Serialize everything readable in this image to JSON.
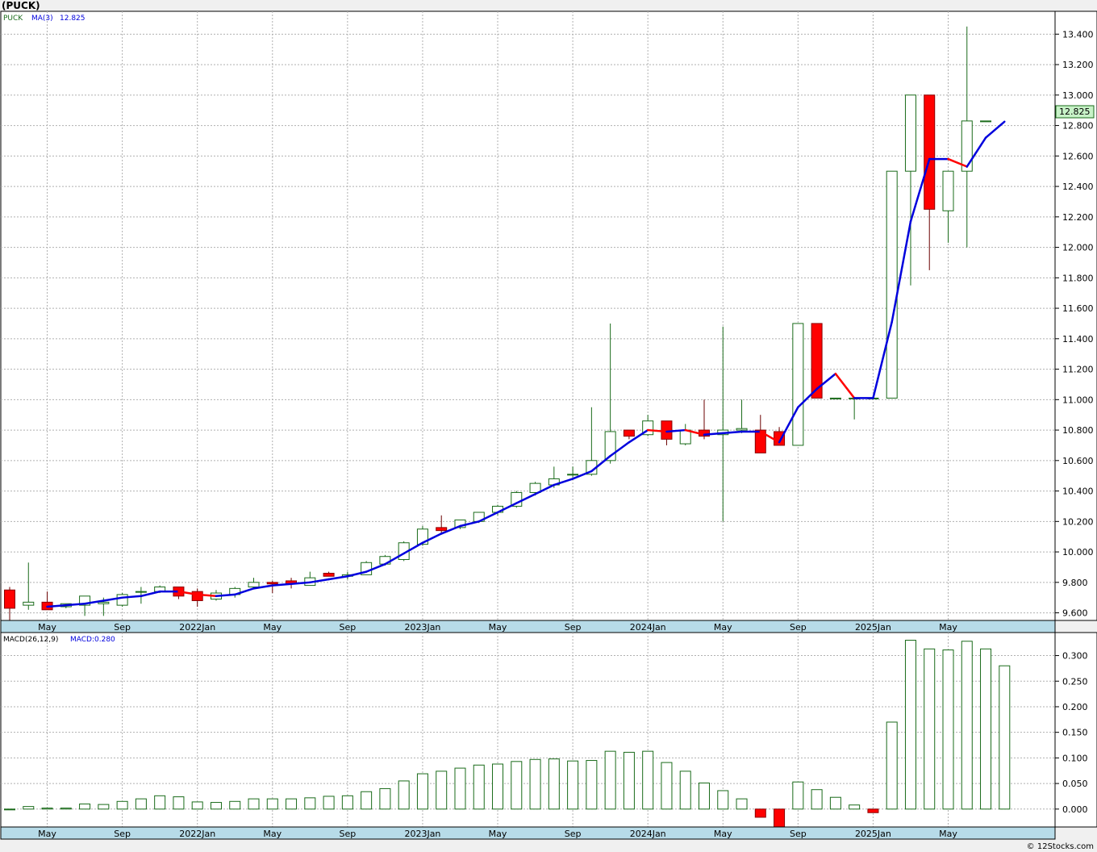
{
  "page_title": "(PUCK)",
  "credit": "© 12Stocks.com",
  "colors": {
    "up": "#1a6b1a",
    "down": "#ff0000",
    "ma_up": "#0000dd",
    "ma_down": "#ff0000",
    "axis_band": "#b7dbe8",
    "last_price_bg": "#c7f2c7"
  },
  "chart_data": [
    {
      "type": "candlestick",
      "legend": {
        "symbol": "PUCK",
        "ma_label": "MA(3)",
        "ma_value": "12.825"
      },
      "ylim": [
        9.55,
        13.55
      ],
      "y_ticks": [
        "9.600",
        "9.800",
        "10.000",
        "10.200",
        "10.400",
        "10.600",
        "10.800",
        "11.000",
        "11.200",
        "11.400",
        "11.600",
        "11.800",
        "12.000",
        "12.200",
        "12.400",
        "12.600",
        "12.800",
        "13.000",
        "13.200",
        "13.400"
      ],
      "last_price_label": "12.825",
      "x_labels": [
        {
          "label": "May",
          "index": 2
        },
        {
          "label": "Sep",
          "index": 6
        },
        {
          "label": "2022Jan",
          "index": 10
        },
        {
          "label": "May",
          "index": 14
        },
        {
          "label": "Sep",
          "index": 18
        },
        {
          "label": "2023Jan",
          "index": 22
        },
        {
          "label": "May",
          "index": 26
        },
        {
          "label": "Sep",
          "index": 30
        },
        {
          "label": "2024Jan",
          "index": 34
        },
        {
          "label": "May",
          "index": 38
        },
        {
          "label": "Sep",
          "index": 42
        },
        {
          "label": "2025Jan",
          "index": 46
        },
        {
          "label": "May",
          "index": 50
        }
      ],
      "candles": [
        [
          9.75,
          9.77,
          9.55,
          9.63
        ],
        [
          9.65,
          9.93,
          9.62,
          9.67
        ],
        [
          9.67,
          9.74,
          9.62,
          9.62
        ],
        [
          9.64,
          9.66,
          9.63,
          9.66
        ],
        [
          9.65,
          9.71,
          9.58,
          9.71
        ],
        [
          9.66,
          9.7,
          9.58,
          9.67
        ],
        [
          9.65,
          9.73,
          9.64,
          9.72
        ],
        [
          9.74,
          9.77,
          9.66,
          9.74
        ],
        [
          9.74,
          9.78,
          9.73,
          9.77
        ],
        [
          9.77,
          9.77,
          9.69,
          9.71
        ],
        [
          9.74,
          9.76,
          9.64,
          9.68
        ],
        [
          9.69,
          9.75,
          9.68,
          9.73
        ],
        [
          9.72,
          9.77,
          9.7,
          9.76
        ],
        [
          9.77,
          9.83,
          9.76,
          9.8
        ],
        [
          9.8,
          9.81,
          9.73,
          9.79
        ],
        [
          9.81,
          9.83,
          9.76,
          9.79
        ],
        [
          9.78,
          9.87,
          9.78,
          9.83
        ],
        [
          9.86,
          9.87,
          9.84,
          9.84
        ],
        [
          9.84,
          9.87,
          9.82,
          9.85
        ],
        [
          9.85,
          9.94,
          9.85,
          9.93
        ],
        [
          9.92,
          9.98,
          9.91,
          9.97
        ],
        [
          9.95,
          10.07,
          9.94,
          10.06
        ],
        [
          10.05,
          10.17,
          10.04,
          10.15
        ],
        [
          10.16,
          10.24,
          10.12,
          10.14
        ],
        [
          10.16,
          10.21,
          10.15,
          10.21
        ],
        [
          10.2,
          10.26,
          10.19,
          10.26
        ],
        [
          10.26,
          10.31,
          10.24,
          10.3
        ],
        [
          10.3,
          10.4,
          10.29,
          10.39
        ],
        [
          10.39,
          10.46,
          10.37,
          10.45
        ],
        [
          10.44,
          10.56,
          10.42,
          10.48
        ],
        [
          10.51,
          10.56,
          10.49,
          10.51
        ],
        [
          10.51,
          10.95,
          10.5,
          10.6
        ],
        [
          10.6,
          11.5,
          10.58,
          10.79
        ],
        [
          10.8,
          10.8,
          10.74,
          10.76
        ],
        [
          10.77,
          10.9,
          10.76,
          10.86
        ],
        [
          10.86,
          10.86,
          10.7,
          10.74
        ],
        [
          10.71,
          10.84,
          10.7,
          10.8
        ],
        [
          10.8,
          11.0,
          10.74,
          10.76
        ],
        [
          10.77,
          11.48,
          10.2,
          10.8
        ],
        [
          10.8,
          11.0,
          10.78,
          10.81
        ],
        [
          10.8,
          10.9,
          10.65,
          10.65
        ],
        [
          10.79,
          10.82,
          10.7,
          10.7
        ],
        [
          10.7,
          11.5,
          10.7,
          11.5
        ],
        [
          11.5,
          11.5,
          11.01,
          11.01
        ],
        [
          11.01,
          11.01,
          11.01,
          11.01
        ],
        [
          11.01,
          11.01,
          10.87,
          11.01
        ],
        [
          11.01,
          11.01,
          11.01,
          11.01
        ],
        [
          11.01,
          12.5,
          11.01,
          12.5
        ],
        [
          12.5,
          13.0,
          11.75,
          13.0
        ],
        [
          13.0,
          13.0,
          11.85,
          12.25
        ],
        [
          12.24,
          12.5,
          12.03,
          12.5
        ],
        [
          12.5,
          13.45,
          12.0,
          12.83
        ],
        [
          12.83,
          12.83,
          12.83,
          12.83
        ]
      ],
      "ma": [
        null,
        null,
        9.64,
        9.65,
        9.66,
        9.68,
        9.7,
        9.71,
        9.74,
        9.74,
        9.72,
        9.71,
        9.72,
        9.76,
        9.78,
        9.79,
        9.8,
        9.82,
        9.84,
        9.87,
        9.92,
        9.99,
        10.06,
        10.12,
        10.17,
        10.2,
        10.26,
        10.32,
        10.38,
        10.44,
        10.48,
        10.53,
        10.63,
        10.72,
        10.8,
        10.79,
        10.8,
        10.77,
        10.78,
        10.79,
        10.79,
        10.72,
        10.95,
        11.07,
        11.17,
        11.01,
        11.01,
        11.51,
        12.17,
        12.58,
        12.58,
        12.53,
        12.72,
        12.825
      ]
    },
    {
      "type": "bar",
      "legend": {
        "label": "MACD(26,12,9)",
        "value_label": "MACD:0.280"
      },
      "ylim": [
        -0.035,
        0.345
      ],
      "y_ticks": [
        "0.000",
        "0.050",
        "0.100",
        "0.150",
        "0.200",
        "0.250",
        "0.300"
      ],
      "x_labels": [
        {
          "label": "May",
          "index": 2
        },
        {
          "label": "Sep",
          "index": 6
        },
        {
          "label": "2022Jan",
          "index": 10
        },
        {
          "label": "May",
          "index": 14
        },
        {
          "label": "Sep",
          "index": 18
        },
        {
          "label": "2023Jan",
          "index": 22
        },
        {
          "label": "May",
          "index": 26
        },
        {
          "label": "Sep",
          "index": 30
        },
        {
          "label": "2024Jan",
          "index": 34
        },
        {
          "label": "May",
          "index": 38
        },
        {
          "label": "Sep",
          "index": 42
        },
        {
          "label": "2025Jan",
          "index": 46
        },
        {
          "label": "May",
          "index": 50
        }
      ],
      "values": [
        0.0,
        0.005,
        0.002,
        0.002,
        0.01,
        0.009,
        0.015,
        0.02,
        0.026,
        0.024,
        0.014,
        0.013,
        0.015,
        0.02,
        0.02,
        0.02,
        0.022,
        0.025,
        0.026,
        0.034,
        0.04,
        0.055,
        0.069,
        0.074,
        0.08,
        0.086,
        0.088,
        0.093,
        0.097,
        0.098,
        0.094,
        0.095,
        0.113,
        0.111,
        0.113,
        0.091,
        0.074,
        0.051,
        0.036,
        0.02,
        -0.016,
        -0.037,
        0.053,
        0.038,
        0.023,
        0.008,
        -0.007,
        0.17,
        0.33,
        0.313,
        0.311,
        0.328,
        0.313,
        0.28
      ]
    }
  ]
}
